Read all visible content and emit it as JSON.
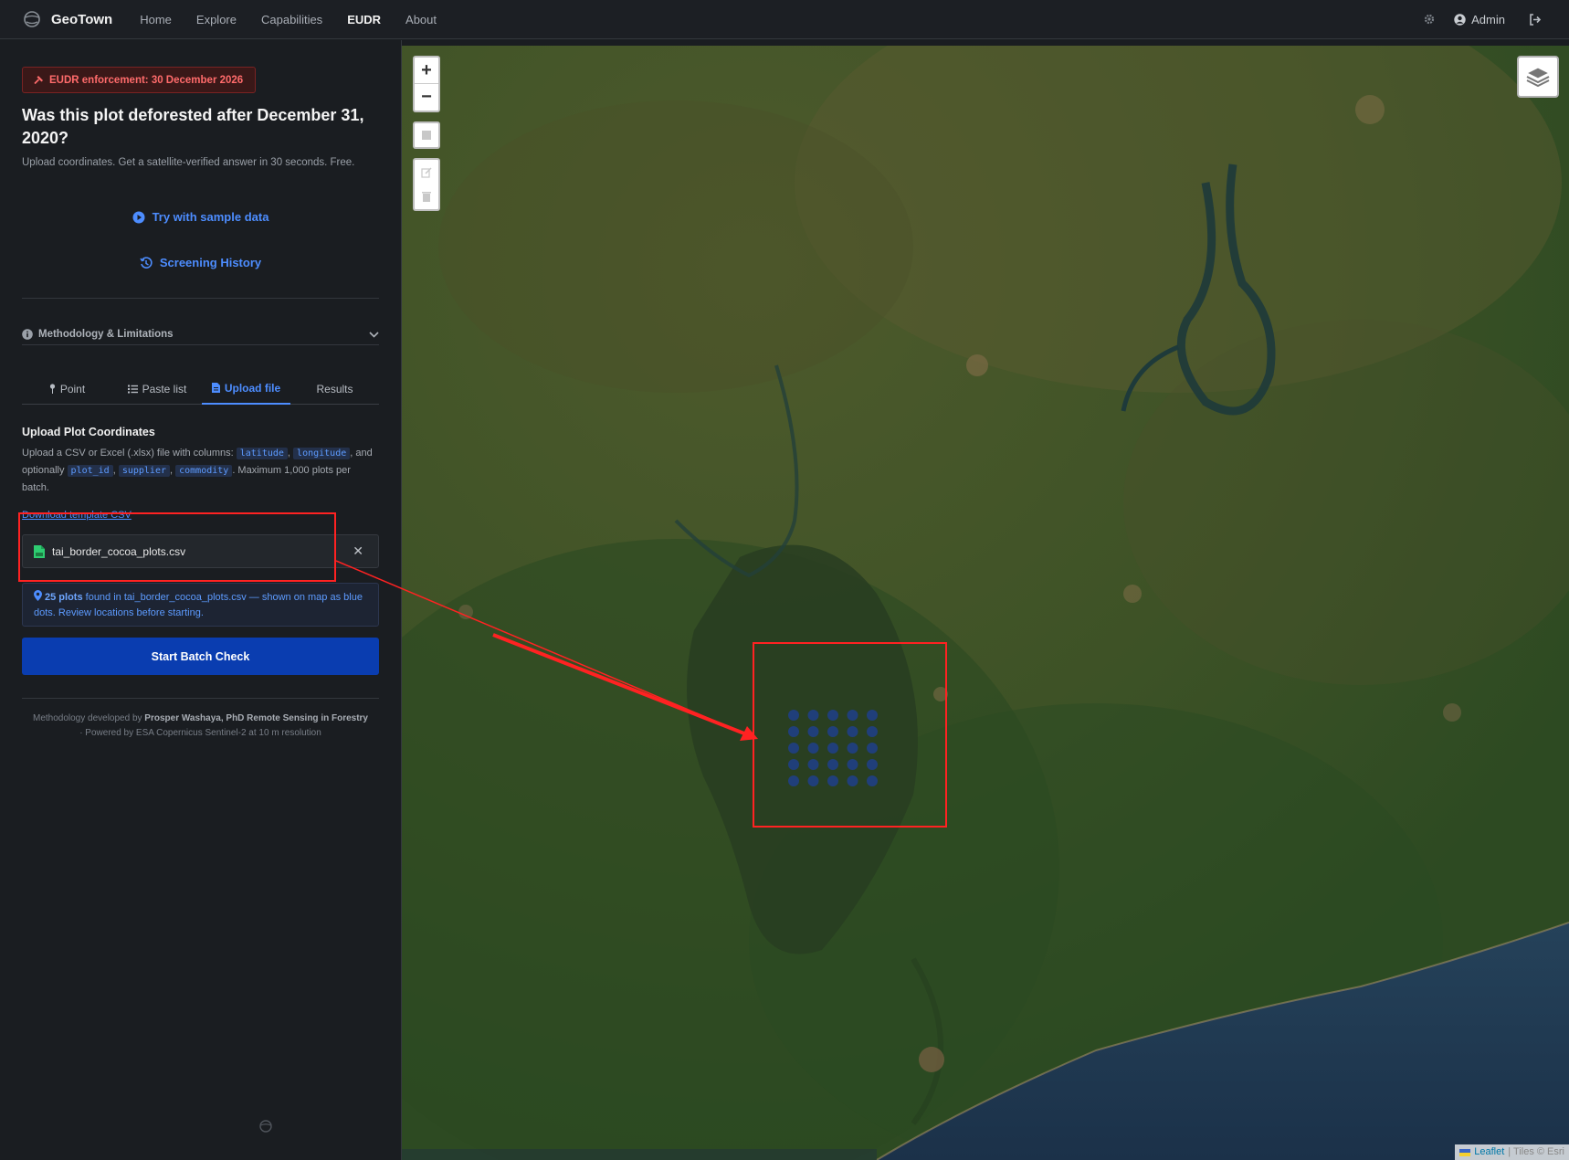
{
  "nav": {
    "brand": "GeoTown",
    "links": [
      "Home",
      "Explore",
      "Capabilities",
      "EUDR",
      "About"
    ],
    "active": "EUDR",
    "user": "Admin"
  },
  "sidebar": {
    "enforcement_badge": "EUDR enforcement: 30 December 2026",
    "headline": "Was this plot deforested after December 31, 2020?",
    "subline": "Upload coordinates. Get a satellite-verified answer in 30 seconds. Free.",
    "sample_link": "Try with sample data",
    "history_link": "Screening History",
    "methodology": "Methodology & Limitations",
    "tabs": [
      {
        "label": "Point",
        "icon": "pin-icon"
      },
      {
        "label": "Paste list",
        "icon": "list-icon"
      },
      {
        "label": "Upload file",
        "icon": "file-icon"
      },
      {
        "label": "Results",
        "icon": ""
      }
    ],
    "active_tab": "Upload file",
    "upload": {
      "title": "Upload Plot Coordinates",
      "desc_1": "Upload a CSV or Excel (.xlsx) file with columns:",
      "col_lat": "latitude",
      "col_lon": "longitude",
      "desc_2": ", and optionally",
      "col_plot": "plot_id",
      "col_supplier": "supplier",
      "col_commodity": "commodity",
      "desc_3": ". Maximum 1,000 plots per batch.",
      "template_link": "Download template CSV",
      "file_name": "tai_border_cocoa_plots.csv",
      "found_count": "25 plots",
      "found_rest": "found in tai_border_cocoa_plots.csv — shown on map as blue dots. Review locations before starting.",
      "start_button": "Start Batch Check"
    },
    "credit_prefix": "Methodology developed by",
    "credit_name": "Prosper Washaya, PhD Remote Sensing in Forestry",
    "credit_suffix": "· Powered by ESA Copernicus Sentinel-2 at 10 m resolution"
  },
  "map": {
    "zoom_in": "+",
    "zoom_out": "−",
    "attribution_leaflet": "Leaflet",
    "attribution_tiles": "| Tiles © Esri",
    "plot_dots": {
      "rows": 5,
      "cols": 5,
      "color": "#1f3f8a"
    }
  },
  "colors": {
    "accent": "#4d8dff",
    "primary_button": "#0a3db0",
    "annotation": "#ff2222",
    "alert": "#ff6b6b"
  }
}
